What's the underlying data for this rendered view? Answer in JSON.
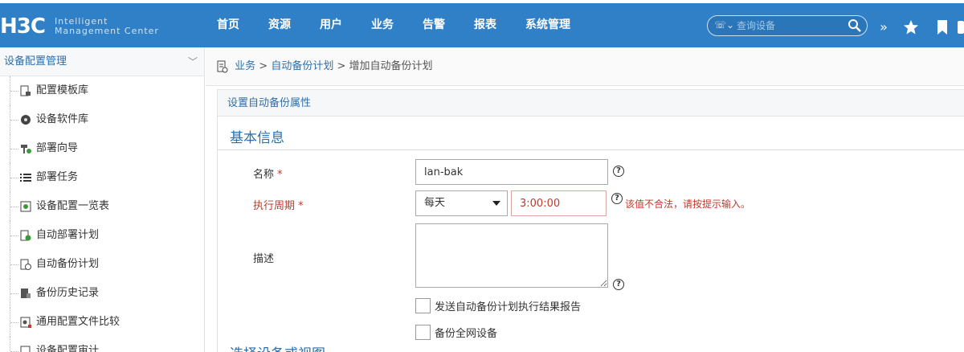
{
  "brand": {
    "logo_main": "H3C",
    "logo_sub_line1": "Intelligent",
    "logo_sub_line2": "Management Center"
  },
  "nav": {
    "items": [
      "首页",
      "资源",
      "用户",
      "业务",
      "告警",
      "报表",
      "系统管理"
    ]
  },
  "search": {
    "placeholder": "查询设备"
  },
  "sidebar": {
    "header": "设备配置管理",
    "items": [
      {
        "label": "配置模板库",
        "icon": "template-icon"
      },
      {
        "label": "设备软件库",
        "icon": "disc-icon"
      },
      {
        "label": "部署向导",
        "icon": "wizard-icon"
      },
      {
        "label": "部署任务",
        "icon": "list-icon"
      },
      {
        "label": "设备配置一览表",
        "icon": "config-overview-icon"
      },
      {
        "label": "自动部署计划",
        "icon": "deploy-plan-icon"
      },
      {
        "label": "自动备份计划",
        "icon": "backup-plan-icon"
      },
      {
        "label": "备份历史记录",
        "icon": "history-icon"
      },
      {
        "label": "通用配置文件比较",
        "icon": "compare-icon"
      },
      {
        "label": "设备配置审计",
        "icon": "audit-icon"
      }
    ]
  },
  "breadcrumb": {
    "part1": "业务",
    "sep": ">",
    "part2": "自动备份计划",
    "part3": "增加自动备份计划"
  },
  "panel": {
    "header": "设置自动备份属性",
    "section_title": "基本信息",
    "section2_title": "选择设备或视图"
  },
  "form": {
    "name_label": "名称",
    "name_value": "lan-bak",
    "required_mark": "*",
    "period_label": "执行周期",
    "period_selected": "每天",
    "time_value": "3:00:00",
    "error_text": "该值不合法，请按提示输入。",
    "desc_label": "描述",
    "checkbox1_label": "发送自动备份计划执行结果报告",
    "checkbox2_label": "备份全网设备",
    "help_glyph": "?"
  },
  "colors": {
    "topbar": "#2f80c6",
    "link": "#2f6fa8",
    "error": "#c0392b"
  }
}
